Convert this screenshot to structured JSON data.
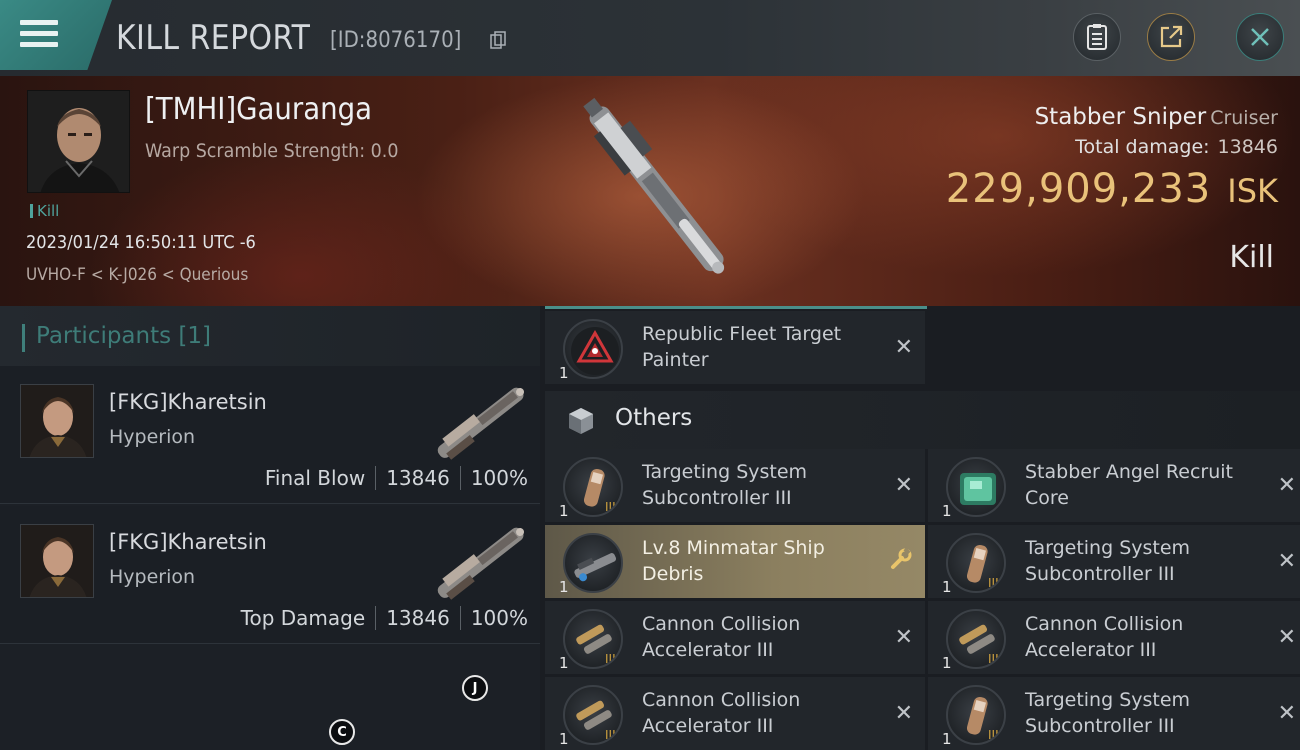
{
  "header": {
    "title": "KILL REPORT",
    "report_id": "[ID:8076170]"
  },
  "victim": {
    "name": "[TMHI]Gauranga",
    "scramble": "Warp Scramble Strength: 0.0",
    "kill_tag": "Kill",
    "datetime": "2023/01/24 16:50:11 UTC -6",
    "location": "UVHO-F < K-J026 < Querious",
    "ship_name": "Stabber Sniper",
    "ship_class": "Cruiser",
    "total_damage_label": "Total damage:",
    "total_damage": "13846",
    "isk_value": "229,909,233",
    "isk_unit": "ISK",
    "result": "Kill"
  },
  "participants": {
    "title": "Participants",
    "count": "[1]",
    "list": [
      {
        "name": "[FKG]Kharetsin",
        "ship": "Hyperion",
        "role": "Final Blow",
        "damage": "13846",
        "percent": "100%"
      },
      {
        "name": "[FKG]Kharetsin",
        "ship": "Hyperion",
        "role": "Top Damage",
        "damage": "13846",
        "percent": "100%"
      }
    ]
  },
  "badges": {
    "j": "J",
    "c": "C"
  },
  "items": {
    "top_item": {
      "name": "Republic Fleet Target Painter",
      "qty": "1"
    },
    "section_title": "Others",
    "list": [
      {
        "name": "Targeting System Subcontroller III",
        "qty": "1"
      },
      {
        "name": "Stabber Angel Recruit Core",
        "qty": "1"
      },
      {
        "name": "Lv.8 Minmatar Ship Debris",
        "qty": "1"
      },
      {
        "name": "Targeting System Subcontroller III",
        "qty": "1"
      },
      {
        "name": "Cannon Collision Accelerator III",
        "qty": "1"
      },
      {
        "name": "Cannon Collision Accelerator III",
        "qty": "1"
      },
      {
        "name": "Cannon Collision Accelerator III",
        "qty": "1"
      },
      {
        "name": "Targeting System Subcontroller III",
        "qty": "1"
      }
    ],
    "remove_glyph": "✕"
  },
  "colors": {
    "accent": "#3f7f7b",
    "isk": "#e9c27a",
    "highlight": "#8b7f5f"
  }
}
